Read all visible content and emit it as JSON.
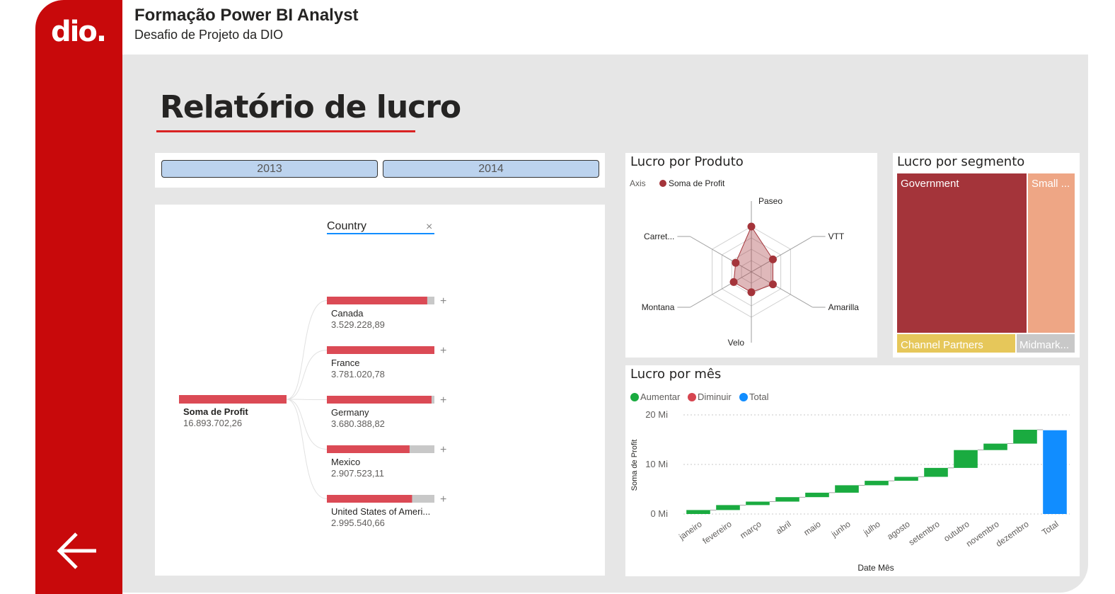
{
  "header": {
    "title": "Formação Power BI Analyst",
    "subtitle": "Desafio de Projeto da DIO",
    "logo_text": "dio."
  },
  "page": {
    "title": "Relatório de lucro"
  },
  "slicer": {
    "options": [
      "2013",
      "2014"
    ]
  },
  "colors": {
    "brand": "#c8090b",
    "tree_bar": "#db4a55",
    "radar": "#a4343a",
    "increase": "#1aab40",
    "decrease": "#d64550",
    "total": "#118dff",
    "treemap_government": "#a4343a",
    "treemap_small": "#eea685",
    "treemap_channel": "#e6c75a",
    "treemap_midmarket": "#c8c8c8"
  },
  "chart_data": [
    {
      "type": "decomposition-tree",
      "filter_label": "Country",
      "root": {
        "label": "Soma de Profit",
        "value": "16.893.702,26"
      },
      "scale_max": 3781020.78,
      "nodes": [
        {
          "label": "Canada",
          "value_text": "3.529.228,89",
          "value": 3529228.89
        },
        {
          "label": "France",
          "value_text": "3.781.020,78",
          "value": 3781020.78
        },
        {
          "label": "Germany",
          "value_text": "3.680.388,82",
          "value": 3680388.82
        },
        {
          "label": "Mexico",
          "value_text": "2.907.523,11",
          "value": 2907523.11
        },
        {
          "label": "United States of Ameri...",
          "value_text": "2.995.540,66",
          "value": 2995540.66
        }
      ]
    },
    {
      "type": "radar",
      "title": "Lucro por Produto",
      "legend_title": "Axis",
      "series_name": "Soma de Profit",
      "axes": [
        "Paseo",
        "VTT",
        "Amarilla",
        "Velo",
        "Montana",
        "Carret..."
      ],
      "values": [
        1.0,
        0.55,
        0.55,
        0.45,
        0.45,
        0.4
      ],
      "rings": 4
    },
    {
      "type": "treemap",
      "title": "Lucro por segmento",
      "segments": [
        {
          "label": "Government",
          "share": 0.557
        },
        {
          "label": "Small ...",
          "share": 0.178
        },
        {
          "label": "Channel Partners",
          "share": 0.09
        },
        {
          "label": "Midmark...",
          "share": 0.043
        }
      ]
    },
    {
      "type": "waterfall",
      "title": "Lucro por mês",
      "legend": [
        "Aumentar",
        "Diminuir",
        "Total"
      ],
      "xlabel": "Date Mês",
      "ylabel": "Soma de Profit",
      "y_ticks": [
        "0 Mi",
        "10 Mi",
        "20 Mi"
      ],
      "y_tick_values": [
        0,
        10,
        20
      ],
      "ylim": [
        0,
        20
      ],
      "categories": [
        "janeiro",
        "fevereiro",
        "março",
        "abril",
        "maio",
        "junho",
        "julho",
        "agosto",
        "setembro",
        "outubro",
        "novembro",
        "dezembro",
        "Total"
      ],
      "values": [
        0.8,
        1.0,
        0.7,
        0.9,
        0.9,
        1.5,
        0.9,
        0.8,
        1.8,
        3.6,
        1.3,
        2.8
      ],
      "total": 16.9
    }
  ]
}
